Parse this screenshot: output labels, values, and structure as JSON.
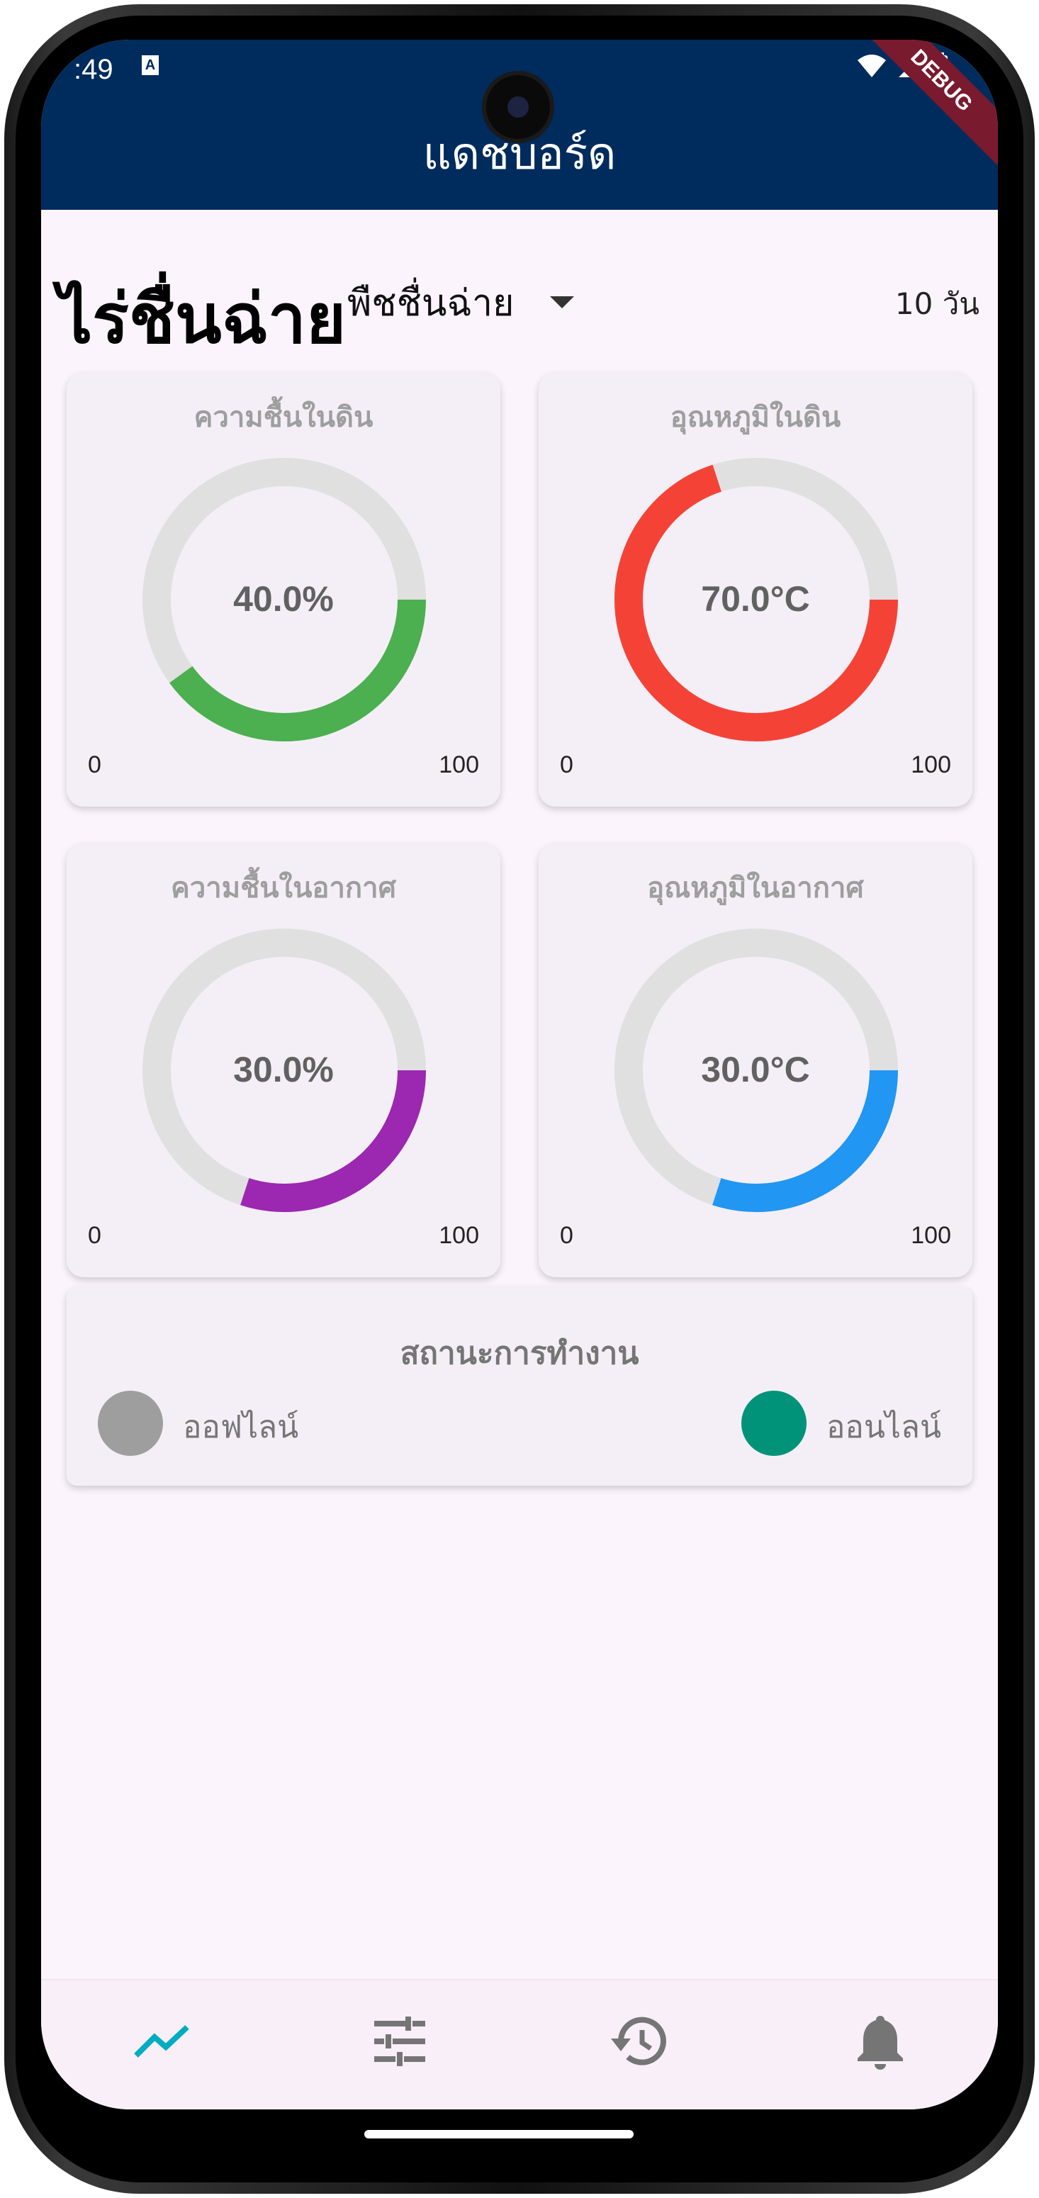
{
  "status_bar": {
    "time": ":49",
    "notification_badge": "A"
  },
  "appbar": {
    "title": "แดชบอร์ด",
    "debug_banner": "DEBUG"
  },
  "farm": {
    "name": "ไร่ชื่นฉ่าย",
    "crop_selected": "พืชชื่นฉ่าย",
    "days": "10 วัน"
  },
  "gauges": [
    {
      "title": "ความชื้นในดิน",
      "value_text": "40.0%",
      "value": 40,
      "min": "0",
      "max": "100",
      "color": "#4caf50"
    },
    {
      "title": "อุณหภูมิในดิน",
      "value_text": "70.0°C",
      "value": 70,
      "min": "0",
      "max": "100",
      "color": "#f44336"
    },
    {
      "title": "ความชื้นในอากาศ",
      "value_text": "30.0%",
      "value": 30,
      "min": "0",
      "max": "100",
      "color": "#9c27b0"
    },
    {
      "title": "อุณหภูมิในอากาศ",
      "value_text": "30.0°C",
      "value": 30,
      "min": "0",
      "max": "100",
      "color": "#2196f3"
    }
  ],
  "status": {
    "title": "สถานะการทำงาน",
    "offline_label": "ออฟไลน์",
    "online_label": "ออนไลน์",
    "offline_color": "#9e9e9e",
    "online_color": "#00937a"
  },
  "bottom_nav": {
    "items": [
      "chart-line-icon",
      "tune-icon",
      "history-icon",
      "bell-icon"
    ],
    "active_color": "#00acc1",
    "inactive_color": "#757575"
  }
}
